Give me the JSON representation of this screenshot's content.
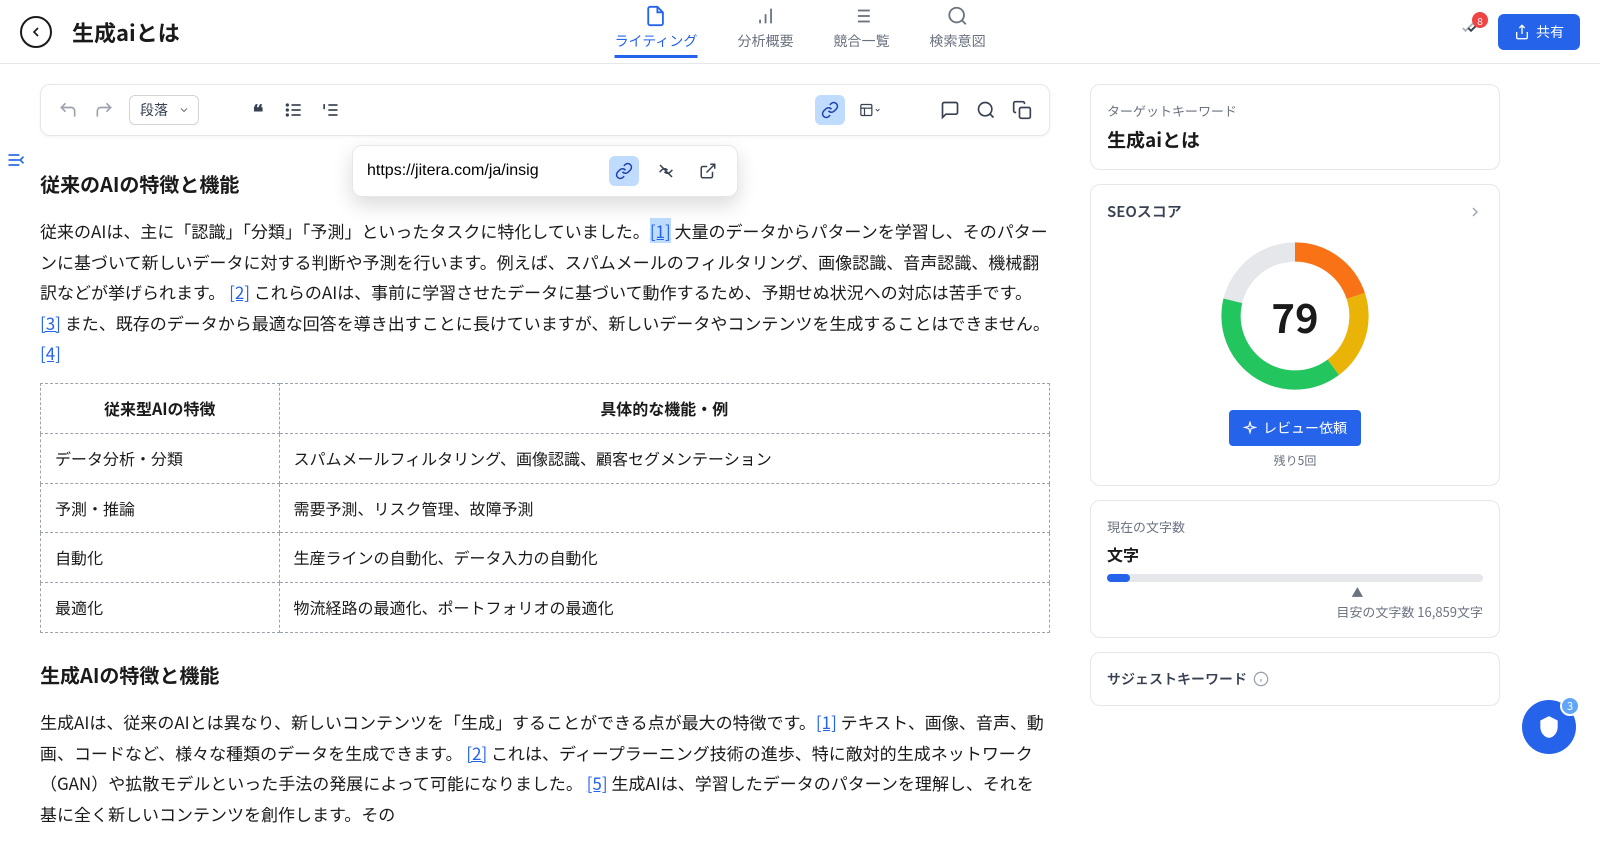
{
  "header": {
    "title": "生成aiとは",
    "share_label": "共有",
    "badge_count": "8"
  },
  "tabs": [
    {
      "label": "ライティング",
      "active": true
    },
    {
      "label": "分析概要",
      "active": false
    },
    {
      "label": "競合一覧",
      "active": false
    },
    {
      "label": "検索意図",
      "active": false
    }
  ],
  "toolbar": {
    "format_label": "段落",
    "link_url": "https://jitera.com/ja/insig"
  },
  "content": {
    "h2_1": "従来のAIの特徴と機能",
    "p1_a": "従来のAIは、主に「認識」「分類」「予測」といったタスクに特化していました。",
    "ref1": "[1]",
    "p1_b": " 大量のデータからパターンを学習し、そのパターンに基づいて新しいデータに対する判断や予測を行います。例えば、スパムメールのフィルタリング、画像認識、音声認識、機械翻訳などが挙げられます。 ",
    "ref2": "[2]",
    "p1_c": " これらのAIは、事前に学習させたデータに基づいて動作するため、予期せぬ状況への対応は苦手です。 ",
    "ref3": "[3]",
    "p1_d": " また、既存のデータから最適な回答を導き出すことに長けていますが、新しいデータやコンテンツを生成することはできません。 ",
    "ref4": "[4]",
    "table": {
      "th1": "従来型AIの特徴",
      "th2": "具体的な機能・例",
      "rows": [
        [
          "データ分析・分類",
          "スパムメールフィルタリング、画像認識、顧客セグメンテーション"
        ],
        [
          "予測・推論",
          "需要予測、リスク管理、故障予測"
        ],
        [
          "自動化",
          "生産ラインの自動化、データ入力の自動化"
        ],
        [
          "最適化",
          "物流経路の最適化、ポートフォリオの最適化"
        ]
      ]
    },
    "h2_2": "生成AIの特徴と機能",
    "p2_a": "生成AIは、従来のAIとは異なり、新しいコンテンツを「生成」することができる点が最大の特徴です。",
    "ref5": "[1]",
    "p2_b": " テキスト、画像、音声、動画、コードなど、様々な種類のデータを生成できます。 ",
    "ref6": "[2]",
    "p2_c": " これは、ディープラーニング技術の進歩、特に敵対的生成ネットワーク（GAN）や拡散モデルといった手法の発展によって可能になりました。 ",
    "ref7": "[5]",
    "p2_d": " 生成AIは、学習したデータのパターンを理解し、それを基に全く新しいコンテンツを創作します。その"
  },
  "sidebar": {
    "target_kw_label": "ターゲットキーワード",
    "target_kw_value": "生成aiとは",
    "seo_score_label": "SEOスコア",
    "seo_score_value": "79",
    "review_btn": "レビュー依頼",
    "remain_label": "残り5回",
    "char_count_label": "現在の文字数",
    "char_unit": "文字",
    "char_target": "目安の文字数 16,859文字",
    "suggest_label": "サジェストキーワード"
  },
  "fab": {
    "count": "3"
  }
}
